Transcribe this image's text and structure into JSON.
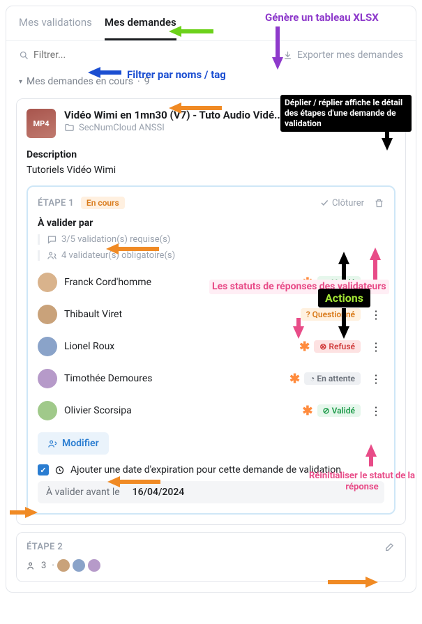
{
  "tabs": {
    "validations": "Mes validations",
    "demandes": "Mes demandes"
  },
  "filter": {
    "placeholder": "Filtrer..."
  },
  "export_label": "Exporter mes demandes",
  "section": {
    "label": "Mes demandes en cours",
    "count": "9"
  },
  "card": {
    "badge": "MP4",
    "title": "Vidéo Wimi en 1mn30 (V7) - Tuto Audio Vidé...",
    "folder": "SecNumCloud ANSSI",
    "desc_label": "Description",
    "desc_text": "Tutoriels Vidéo Wimi"
  },
  "step1": {
    "label": "ÉTAPE 1",
    "status": "En cours",
    "close_label": "Clôturer",
    "validate_by": "À valider par",
    "req1": "3/5 validation(s) requise(s)",
    "req2": "4 validateur(s) obligatoire(s)",
    "validators": [
      {
        "name": "Franck Cord'homme",
        "status": "Validé",
        "status_class": "valide",
        "ico": "⊘",
        "required": true
      },
      {
        "name": "Thibault Viret",
        "status": "Questionné",
        "status_class": "question",
        "ico": "?",
        "required": false
      },
      {
        "name": "Lionel Roux",
        "status": "Refusé",
        "status_class": "refuse",
        "ico": "⊗",
        "required": true
      },
      {
        "name": "Timothée Demoures",
        "status": "En attente",
        "status_class": "wait",
        "ico": "◔",
        "required": true
      },
      {
        "name": "Olivier Scorsipa",
        "status": "Validé",
        "status_class": "valide",
        "ico": "⊘",
        "required": true
      }
    ],
    "modify_label": "Modifier",
    "expiry_label": "Ajouter une date d'expiration pour cette demande de validation",
    "expiry_before": "À valider avant le",
    "expiry_date": "16/04/2024"
  },
  "step2": {
    "label": "ÉTAPE 2",
    "count": "3"
  },
  "annotations": {
    "xlsx": "Génère un tableau XLSX",
    "filter": "Filtrer par noms / tag",
    "unfold": "Déplier / réplier affiche le détail des étapes d'une demande de validation",
    "statuses": "Les statuts de réponses des validateurs",
    "actions": "Actions",
    "reset": "Réinitialiser le statut de la réponse"
  }
}
